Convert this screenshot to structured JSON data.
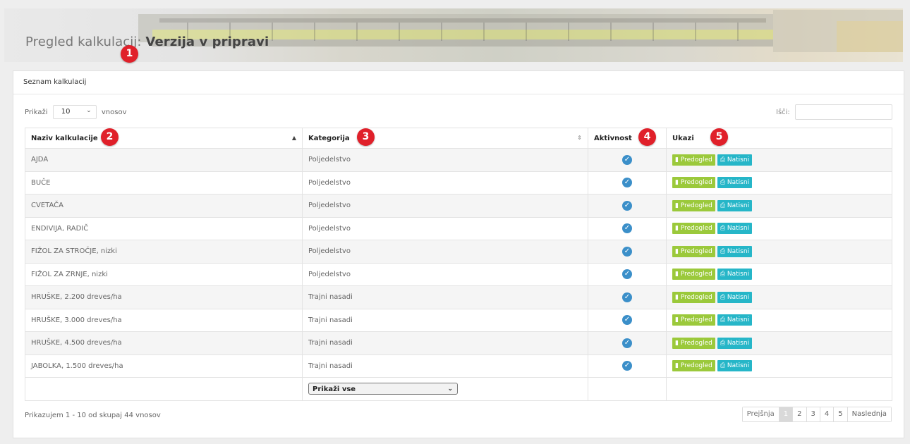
{
  "header": {
    "title_prefix": "Pregled kalkulacij:",
    "title_bold": "Verzija v pripravi"
  },
  "markers": [
    "1",
    "2",
    "3",
    "4",
    "5"
  ],
  "panel": {
    "heading": "Seznam kalkulacij",
    "length_prefix": "Prikaži",
    "length_value": "10",
    "length_suffix": "vnosov",
    "search_label": "Išči:",
    "search_value": ""
  },
  "table": {
    "columns": [
      "Naziv kalkulacije",
      "Kategorija",
      "Aktivnost",
      "Ukazi"
    ],
    "action_preview": "Predogled",
    "action_print": "Natisni",
    "rows": [
      {
        "name": "AJDA",
        "category": "Poljedelstvo",
        "active": true
      },
      {
        "name": "BUČE",
        "category": "Poljedelstvo",
        "active": true
      },
      {
        "name": "CVETAČA",
        "category": "Poljedelstvo",
        "active": true
      },
      {
        "name": "ENDIVIJA, RADIČ",
        "category": "Poljedelstvo",
        "active": true
      },
      {
        "name": "FIŽOL ZA STROČJE, nizki",
        "category": "Poljedelstvo",
        "active": true
      },
      {
        "name": "FIŽOL ZA ZRNJE, nizki",
        "category": "Poljedelstvo",
        "active": true
      },
      {
        "name": "HRUŠKE, 2.200 dreves/ha",
        "category": "Trajni nasadi",
        "active": true
      },
      {
        "name": "HRUŠKE, 3.000 dreves/ha",
        "category": "Trajni nasadi",
        "active": true
      },
      {
        "name": "HRUŠKE, 4.500 dreves/ha",
        "category": "Trajni nasadi",
        "active": true
      },
      {
        "name": "JABOLKA, 1.500 dreves/ha",
        "category": "Trajni nasadi",
        "active": true
      }
    ],
    "category_filter": "Prikaži vse"
  },
  "footer": {
    "info": "Prikazujem 1 - 10 od skupaj 44 vnosov",
    "pager": {
      "prev": "Prejšnja",
      "pages": [
        "1",
        "2",
        "3",
        "4",
        "5"
      ],
      "active_page": "1",
      "next": "Naslednja"
    }
  },
  "colors": {
    "preview_button": "#9bc93b",
    "print_button": "#26b6c8",
    "active_check": "#3b8fc9",
    "marker": "#e0202a"
  }
}
